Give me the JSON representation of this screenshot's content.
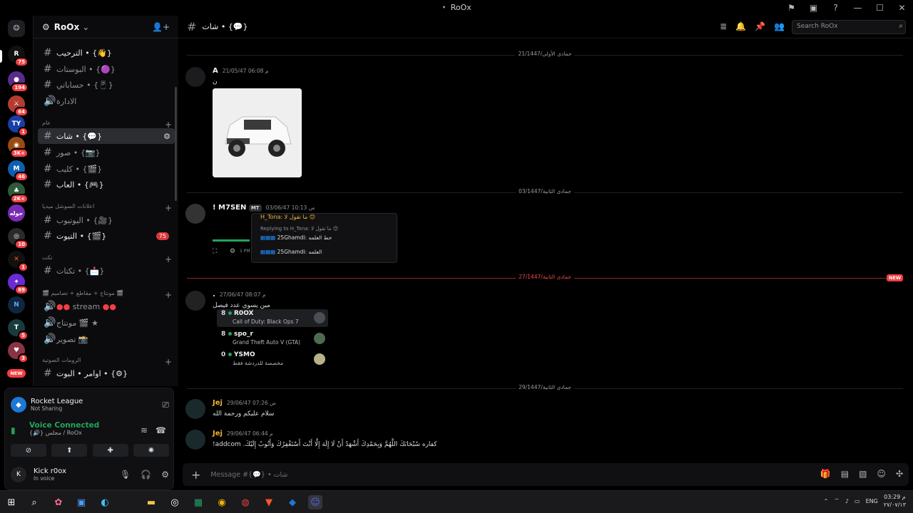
{
  "window": {
    "title": "RoOx"
  },
  "titlebar_icons": [
    "inbox-icon",
    "device-icon",
    "help-icon",
    "minimize-icon",
    "maximize-icon",
    "close-icon"
  ],
  "server_list": {
    "badges": [
      "75",
      "194",
      "64",
      "1",
      "3K+",
      "46",
      "2K+",
      "10",
      "1",
      "69",
      "5",
      "3"
    ],
    "new_label": "NEW",
    "joleh_label": "جوله"
  },
  "sidebar": {
    "server_name": "RoOx",
    "channels": [
      {
        "label": "الترحيب • {👋}"
      },
      {
        "label": "البوستات • {🟣}"
      },
      {
        "label": "حساباتي • {📱}"
      },
      {
        "label": "الادارة"
      },
      {
        "label": "شات • {💬}"
      },
      {
        "label": "صور • {📷}"
      },
      {
        "label": "كليب • {🎬}"
      },
      {
        "label": "العاب • {🎮}"
      },
      {
        "label": "اليوتيوب • {🎥}"
      },
      {
        "label": "التيوت • {🎬}"
      },
      {
        "label": "تكتات • {📩}"
      },
      {
        "label": "stream"
      },
      {
        "label": "مونتاج 🎬 ★"
      },
      {
        "label": "تصوير 📸"
      },
      {
        "label": "اوامر • البوت • {⚙}"
      }
    ],
    "categories": [
      "عام",
      "اعلانات السوشل ميديا",
      "تكت",
      "🎬 مونتاج + مقاطع + تصاميم 🎬",
      "الرومات الصوتية"
    ],
    "unread_count": "75"
  },
  "activity": {
    "game": "Rocket League",
    "status": "Not Sharing"
  },
  "voice": {
    "title": "Voice Connected",
    "channel": "{🔊} مجلس / RoOx"
  },
  "user": {
    "name": "Kick r0ox",
    "status": "In voice"
  },
  "channel_header": {
    "name": "شات • {💬}",
    "search_placeholder": "Search RoOx"
  },
  "dividers": [
    "21/جمادى الأولى/1447",
    "03/جمادى الثانية/1447",
    "27/جمادى الثانية/1447",
    "29/جمادى الثانية/1447"
  ],
  "new_label": "NEW",
  "messages": [
    {
      "author": "A",
      "time": "21/05/47 06:08 م",
      "text": "ن"
    },
    {
      "author": "! M7SEN",
      "tag": "MT",
      "time": "03/06/47 10:13 ص",
      "text": ""
    },
    {
      "author": ".",
      "time": "27/06/47 08:07 م",
      "text": "مين يسوي عدد فيصل"
    },
    {
      "author": "Jej",
      "time": "29/06/47 07:26 ص",
      "text": "سلام عليكم ورحمة الله"
    },
    {
      "author": "Jej",
      "time": "29/06/47 06:44 م",
      "text": "!addcom .كفاره سُبْحَانَكَ اللَّهُمَّ وَبِحَمْدِكَ أَشْهَدُ أَنْ لَا إِلَهَ إِلَّا أَنْتَ أَسْتَغْفِرُكَ وَأَتُوبُ إِلَيْكَ"
    }
  ],
  "embed": {
    "reply_to": "H_Tona: ما تقول لا 😊",
    "replying": "Replying to H_Tona: ما تقول لا 😊",
    "line1": "25Ghamdi: حط العلمه",
    "line2": "25Ghamdi: العلمه",
    "time": "1 PM"
  },
  "ranking": [
    {
      "n": "8",
      "user": "R0OX",
      "game": "Call of Duty: Black Ops 7"
    },
    {
      "n": "8",
      "user": "spo_r",
      "game": "Grand Theft Auto V (GTA)"
    },
    {
      "n": "0",
      "user": "YSMO",
      "game": "مخصصة للدردشة فقط"
    }
  ],
  "composer": {
    "placeholder": "Message #{💬} • شات"
  },
  "taskbar": {
    "lang": "ENG",
    "time": "03:29 م",
    "date": "٢٧/٠٧/١٣"
  }
}
